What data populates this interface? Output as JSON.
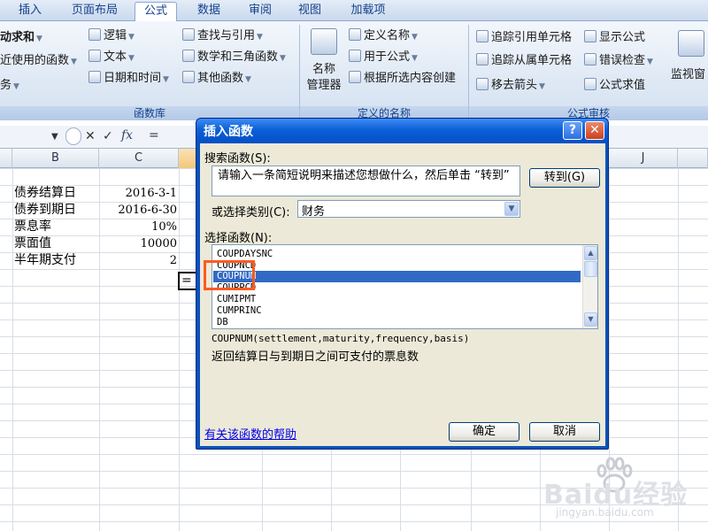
{
  "ribbon": {
    "tabs": [
      {
        "label": "插入"
      },
      {
        "label": "页面布局"
      },
      {
        "label": "公式",
        "active": true
      },
      {
        "label": "数据"
      },
      {
        "label": "审阅"
      },
      {
        "label": "视图"
      },
      {
        "label": "加载项"
      }
    ],
    "function_library": {
      "autosum": "动求和",
      "recent": "近使用的函数",
      "financial": "务",
      "logical": "逻辑",
      "text": "文本",
      "datetime": "日期和时间",
      "lookup": "查找与引用",
      "math": "数学和三角函数",
      "more": "其他函数",
      "label": "函数库"
    },
    "defined_names": {
      "name_manager_line1": "名称",
      "name_manager_line2": "管理器",
      "define_name": "定义名称",
      "use_in_formula": "用于公式",
      "create_from_selection": "根据所选内容创建",
      "label": "定义的名称"
    },
    "formula_auditing": {
      "trace_precedents": "追踪引用单元格",
      "trace_dependents": "追踪从属单元格",
      "remove_arrows": "移去箭头",
      "show_formulas": "显示公式",
      "error_checking": "错误检查",
      "evaluate_formula": "公式求值",
      "label": "公式审核",
      "watch_window": "监视窗"
    }
  },
  "formula_bar": {
    "fx": "fx",
    "content": "="
  },
  "sheet": {
    "columns": [
      "B",
      "C",
      "J"
    ],
    "rows": [
      {
        "label": "债券结算日",
        "value": "2016-3-1"
      },
      {
        "label": "债券到期日",
        "value": "2016-6-30"
      },
      {
        "label": "票息率",
        "value": "10%"
      },
      {
        "label": "票面值",
        "value": "10000"
      },
      {
        "label": "半年期支付",
        "value": "2"
      }
    ],
    "active_cell_content": "="
  },
  "dialog": {
    "title": "插入函数",
    "help_glyph": "?",
    "close_glyph": "✕",
    "search_label": "搜索函数(S):",
    "search_value": "请输入一条简短说明来描述您想做什么，然后单击 “转到”",
    "go_button": "转到(G)",
    "category_label": "或选择类别(C):",
    "category_value": "财务",
    "select_label": "选择函数(N):",
    "functions": [
      "COUPDAYSNC",
      "COUPNCD",
      "COUPNUM",
      "COUPPCD",
      "CUMIPMT",
      "CUMPRINC",
      "DB"
    ],
    "selected_function": "COUPNUM",
    "signature": "COUPNUM(settlement,maturity,frequency,basis)",
    "description": "返回结算日与到期日之间可支付的票息数",
    "help_link": "有关该函数的帮助",
    "ok_button": "确定",
    "cancel_button": "取消"
  },
  "watermark": {
    "brand": "Baidu经验",
    "url": "jingyan.baidu.com"
  }
}
